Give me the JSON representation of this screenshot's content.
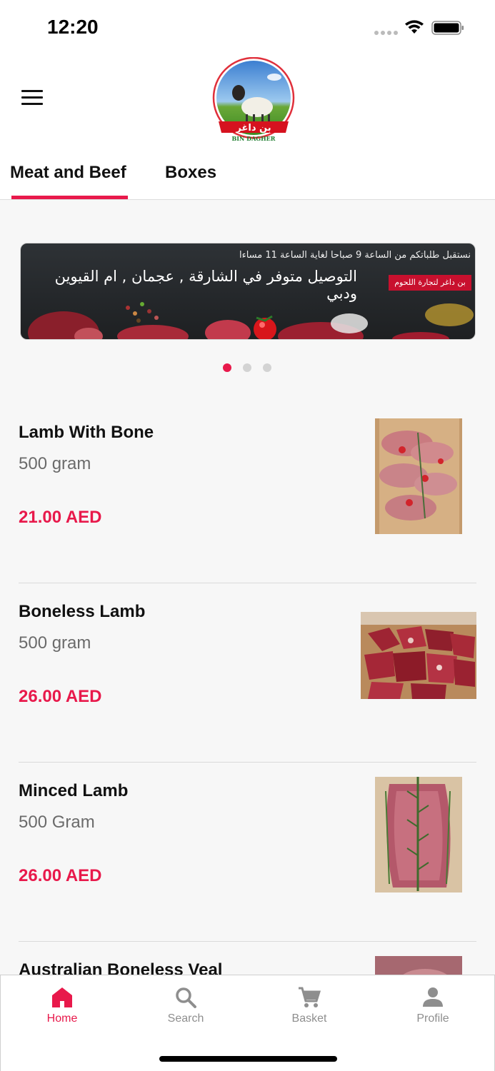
{
  "status_bar": {
    "time": "12:20"
  },
  "header": {
    "logo_text_ar": "بن داغر",
    "logo_text_en": "BIN DAGHER"
  },
  "tabs": [
    {
      "label": "Meat and Beef",
      "active": true
    },
    {
      "label": "Boxes",
      "active": false
    }
  ],
  "banner": {
    "line1": "نستقبل طلباتكم من الساعة 9 صباحا لغاية الساعة 11 مساءا",
    "line2": "التوصيل متوفر في الشارقة , عجمان , ام القيوين ودبي",
    "badge": "بن داغر لتجارة اللحوم",
    "slide_count": 3,
    "active_slide": 0
  },
  "products": [
    {
      "name": "Lamb With Bone",
      "weight": "500 gram",
      "price": "21.00 AED",
      "image": "lamb-with-bone-photo"
    },
    {
      "name": "Boneless Lamb",
      "weight": "500 gram",
      "price": "26.00 AED",
      "image": "boneless-lamb-photo"
    },
    {
      "name": "Minced Lamb",
      "weight": "500 Gram",
      "price": "26.00 AED",
      "image": "minced-lamb-photo"
    },
    {
      "name": "Australian Boneless Veal",
      "weight": "",
      "price": "",
      "image": "veal-photo"
    }
  ],
  "bottom_nav": [
    {
      "label": "Home",
      "icon": "home-icon",
      "active": true
    },
    {
      "label": "Search",
      "icon": "search-icon",
      "active": false
    },
    {
      "label": "Basket",
      "icon": "cart-icon",
      "active": false
    },
    {
      "label": "Profile",
      "icon": "person-icon",
      "active": false
    }
  ],
  "colors": {
    "accent": "#e8194b",
    "inactive": "#8e8e8e",
    "background": "#f7f7f7"
  }
}
